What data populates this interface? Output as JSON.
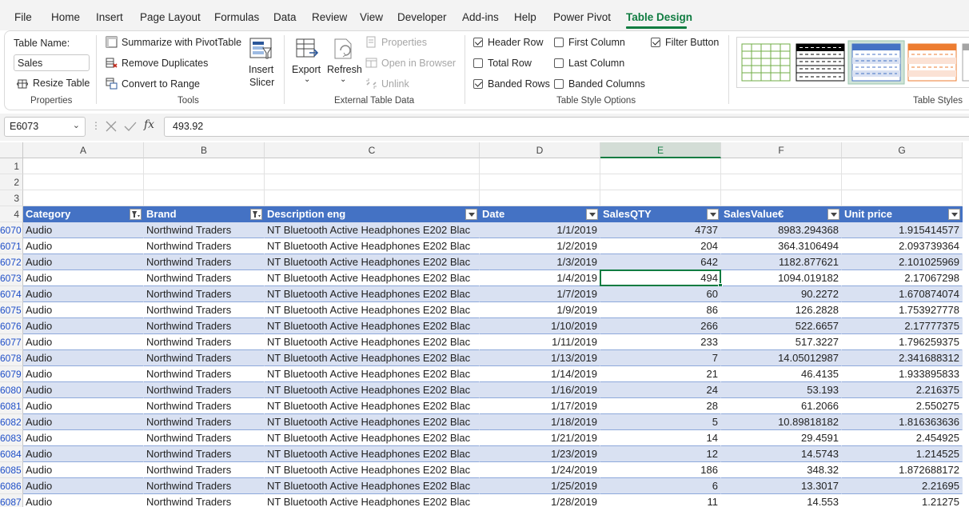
{
  "menu": {
    "tabs": [
      "File",
      "Home",
      "Insert",
      "Page Layout",
      "Formulas",
      "Data",
      "Review",
      "View",
      "Developer",
      "Add-ins",
      "Help",
      "Power Pivot",
      "Table Design"
    ],
    "active": "Table Design"
  },
  "ribbon": {
    "properties": {
      "table_name_label": "Table Name:",
      "table_name_value": "Sales",
      "resize_label": "Resize Table",
      "group_label": "Properties"
    },
    "tools": {
      "summarize_label": "Summarize with PivotTable",
      "remove_duplicates_label": "Remove Duplicates",
      "convert_label": "Convert to Range",
      "insert_slicer_line1": "Insert",
      "insert_slicer_line2": "Slicer",
      "group_label": "Tools"
    },
    "external": {
      "export_label": "Export",
      "refresh_label": "Refresh",
      "properties_label": "Properties",
      "open_browser_label": "Open in Browser",
      "unlink_label": "Unlink",
      "group_label": "External Table Data"
    },
    "style_options": {
      "header_row": "Header Row",
      "total_row": "Total Row",
      "banded_rows": "Banded Rows",
      "first_column": "First Column",
      "last_column": "Last Column",
      "banded_columns": "Banded Columns",
      "filter_button": "Filter Button",
      "group_label": "Table Style Options",
      "checked": {
        "header_row": true,
        "total_row": false,
        "banded_rows": true,
        "first_column": false,
        "last_column": false,
        "banded_columns": false,
        "filter_button": true
      }
    },
    "table_styles": {
      "group_label": "Table Styles"
    }
  },
  "formula_bar": {
    "name_box": "E6073",
    "formula": "493.92"
  },
  "grid": {
    "columns": [
      "A",
      "B",
      "C",
      "D",
      "E",
      "F",
      "G"
    ],
    "selected_column": "E",
    "empty_rows": [
      "1",
      "2",
      "3"
    ],
    "header_row_number": "4",
    "table_headers": [
      "Category",
      "Brand",
      "Description eng",
      "Date",
      "SalesQTY",
      "SalesValue€",
      "Unit price"
    ],
    "rows": [
      {
        "num": "6070",
        "cells": [
          "Audio",
          "Northwind Traders",
          "NT Bluetooth Active Headphones E202 Blac",
          "1/1/2019",
          "4737",
          "8983.294368",
          "1.915414577"
        ]
      },
      {
        "num": "6071",
        "cells": [
          "Audio",
          "Northwind Traders",
          "NT Bluetooth Active Headphones E202 Blac",
          "1/2/2019",
          "204",
          "364.3106494",
          "2.093739364"
        ]
      },
      {
        "num": "6072",
        "cells": [
          "Audio",
          "Northwind Traders",
          "NT Bluetooth Active Headphones E202 Blac",
          "1/3/2019",
          "642",
          "1182.877621",
          "2.101025969"
        ]
      },
      {
        "num": "6073",
        "cells": [
          "Audio",
          "Northwind Traders",
          "NT Bluetooth Active Headphones E202 Blac",
          "1/4/2019",
          "494",
          "1094.019182",
          "2.17067298"
        ]
      },
      {
        "num": "6074",
        "cells": [
          "Audio",
          "Northwind Traders",
          "NT Bluetooth Active Headphones E202 Blac",
          "1/7/2019",
          "60",
          "90.2272",
          "1.670874074"
        ]
      },
      {
        "num": "6075",
        "cells": [
          "Audio",
          "Northwind Traders",
          "NT Bluetooth Active Headphones E202 Blac",
          "1/9/2019",
          "86",
          "126.2828",
          "1.753927778"
        ]
      },
      {
        "num": "6076",
        "cells": [
          "Audio",
          "Northwind Traders",
          "NT Bluetooth Active Headphones E202 Blac",
          "1/10/2019",
          "266",
          "522.6657",
          "2.17777375"
        ]
      },
      {
        "num": "6077",
        "cells": [
          "Audio",
          "Northwind Traders",
          "NT Bluetooth Active Headphones E202 Blac",
          "1/11/2019",
          "233",
          "517.3227",
          "1.796259375"
        ]
      },
      {
        "num": "6078",
        "cells": [
          "Audio",
          "Northwind Traders",
          "NT Bluetooth Active Headphones E202 Blac",
          "1/13/2019",
          "7",
          "14.05012987",
          "2.341688312"
        ]
      },
      {
        "num": "6079",
        "cells": [
          "Audio",
          "Northwind Traders",
          "NT Bluetooth Active Headphones E202 Blac",
          "1/14/2019",
          "21",
          "46.4135",
          "1.933895833"
        ]
      },
      {
        "num": "6080",
        "cells": [
          "Audio",
          "Northwind Traders",
          "NT Bluetooth Active Headphones E202 Blac",
          "1/16/2019",
          "24",
          "53.193",
          "2.216375"
        ]
      },
      {
        "num": "6081",
        "cells": [
          "Audio",
          "Northwind Traders",
          "NT Bluetooth Active Headphones E202 Blac",
          "1/17/2019",
          "28",
          "61.2066",
          "2.550275"
        ]
      },
      {
        "num": "6082",
        "cells": [
          "Audio",
          "Northwind Traders",
          "NT Bluetooth Active Headphones E202 Blac",
          "1/18/2019",
          "5",
          "10.89818182",
          "1.816363636"
        ]
      },
      {
        "num": "6083",
        "cells": [
          "Audio",
          "Northwind Traders",
          "NT Bluetooth Active Headphones E202 Blac",
          "1/21/2019",
          "14",
          "29.4591",
          "2.454925"
        ]
      },
      {
        "num": "6084",
        "cells": [
          "Audio",
          "Northwind Traders",
          "NT Bluetooth Active Headphones E202 Blac",
          "1/23/2019",
          "12",
          "14.5743",
          "1.214525"
        ]
      },
      {
        "num": "6085",
        "cells": [
          "Audio",
          "Northwind Traders",
          "NT Bluetooth Active Headphones E202 Blac",
          "1/24/2019",
          "186",
          "348.32",
          "1.872688172"
        ]
      },
      {
        "num": "6086",
        "cells": [
          "Audio",
          "Northwind Traders",
          "NT Bluetooth Active Headphones E202 Blac",
          "1/25/2019",
          "6",
          "13.3017",
          "2.21695"
        ]
      },
      {
        "num": "6087",
        "cells": [
          "Audio",
          "Northwind Traders",
          "NT Bluetooth Active Headphones E202 Blac",
          "1/28/2019",
          "11",
          "14.553",
          "1.21275"
        ]
      }
    ],
    "active_cell": {
      "row": "6073",
      "column": "E"
    }
  },
  "colors": {
    "accent": "#107c41",
    "table_header": "#4472c4",
    "band": "#d9e1f2",
    "filtered_row_number": "#1f4fc8"
  }
}
